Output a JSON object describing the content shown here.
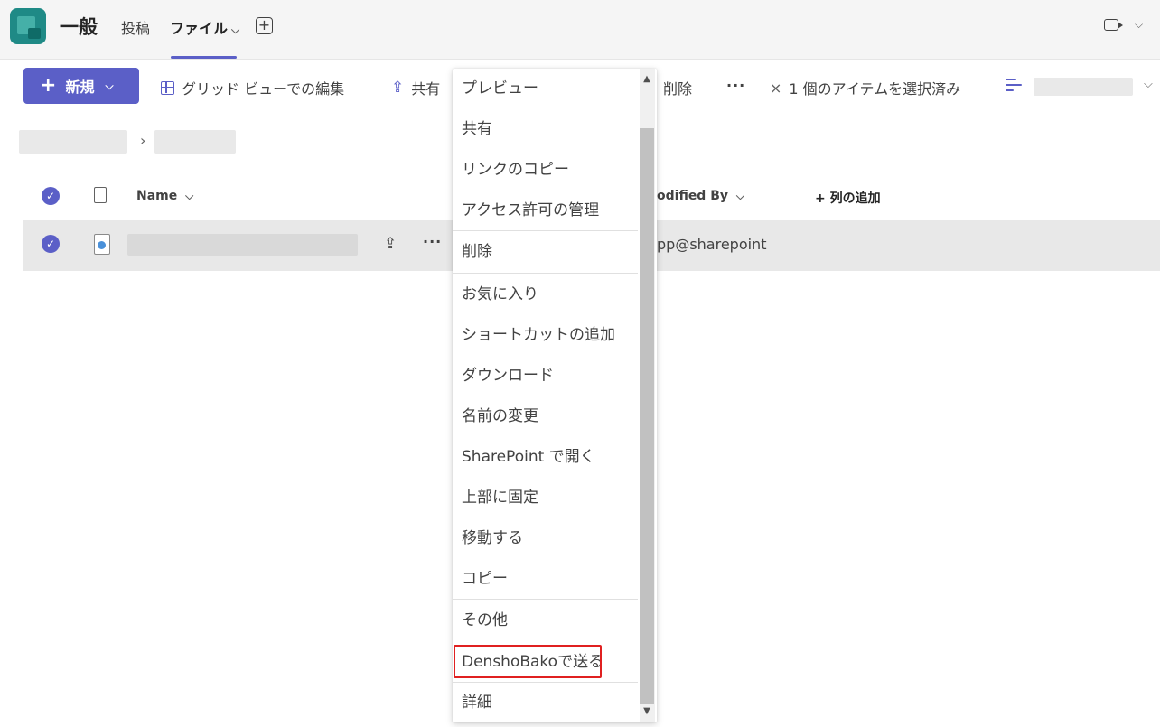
{
  "header": {
    "channel_title": "一般",
    "tabs": [
      {
        "label": "投稿"
      },
      {
        "label": "ファイル",
        "chevron": "⌵"
      }
    ],
    "add_tab_glyph": "+",
    "video_chevron": "⌵"
  },
  "toolbar": {
    "new_label": "新規",
    "new_plus": "+",
    "new_chevron": "⌵",
    "grid_edit_label": "グリッド ビューでの編集",
    "share_label": "共有",
    "delete_label": "削除",
    "more_label": "···",
    "selected_label": "1 個のアイテムを選択済み",
    "clear_glyph": "×",
    "view_chevron": "⌵"
  },
  "breadcrumb": {
    "separator": "›"
  },
  "list": {
    "columns": {
      "name": "Name",
      "name_chevron": "⌵",
      "modified_by": "odified By",
      "modified_chevron": "⌵",
      "add_column": "+ 列の追加"
    },
    "rows": [
      {
        "modified_by": "pp@sharepoint",
        "share_glyph": "⇪",
        "more_glyph": "···"
      }
    ],
    "check_glyph": "✓"
  },
  "context_menu": {
    "items": [
      {
        "label": "プレビュー"
      },
      {
        "label": "共有"
      },
      {
        "label": "リンクのコピー"
      },
      {
        "label": "アクセス許可の管理"
      },
      {
        "label": "削除"
      },
      {
        "label": "お気に入り"
      },
      {
        "label": "ショートカットの追加"
      },
      {
        "label": "ダウンロード"
      },
      {
        "label": "名前の変更"
      },
      {
        "label": "SharePoint で開く"
      },
      {
        "label": "上部に固定"
      },
      {
        "label": "移動する"
      },
      {
        "label": "コピー"
      },
      {
        "label": "その他"
      },
      {
        "label": "DenshoBakoで送る"
      },
      {
        "label": "詳細"
      }
    ],
    "scroll_up_glyph": "▲",
    "scroll_down_glyph": "▼"
  },
  "colors": {
    "accent": "#5b5fc7",
    "highlight_border": "#e02020",
    "app_logo": "#1f8a86"
  }
}
